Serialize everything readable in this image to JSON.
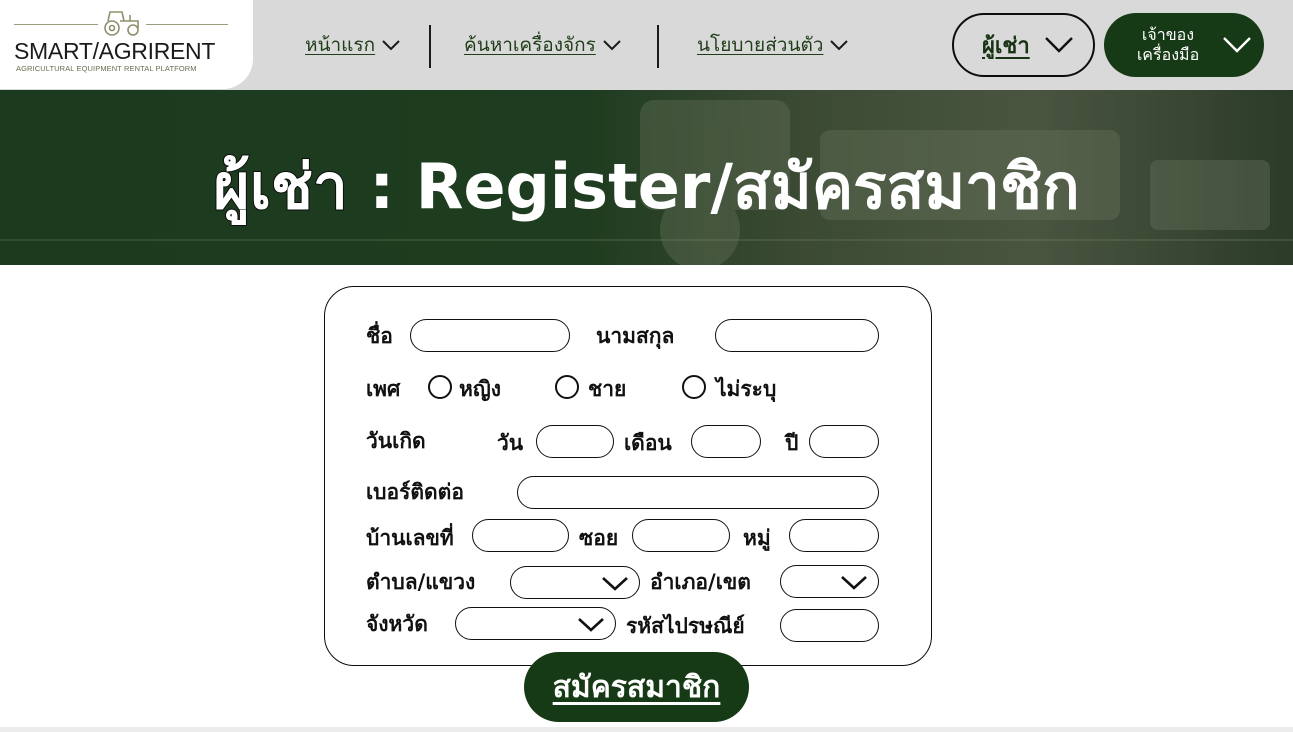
{
  "logo": {
    "title": "SMART/AGRIRENT",
    "subtitle": "AGRICULTURAL EQUIPMENT RENTAL PLATFORM"
  },
  "nav": {
    "home": "หน้าแรก",
    "search_machines": "ค้นหาเครื่องจักร",
    "privacy_policy": "นโยบายส่วนตัว"
  },
  "account_buttons": {
    "renter": "ผู้เช่า",
    "owner_line1": "เจ้าของ",
    "owner_line2": "เครื่องมือ"
  },
  "banner": {
    "role": "ผู้เช่า",
    "separator": " : ",
    "title": "Register/สมัครสมาชิก"
  },
  "form": {
    "first_name_label": "ชื่อ",
    "first_name_value": "",
    "last_name_label": "นามสกุล",
    "last_name_value": "",
    "gender_label": "เพศ",
    "gender_options": [
      "หญิง",
      "ชาย",
      "ไม่ระบุ"
    ],
    "birthdate_label": "วันเกิด",
    "day_label": "วัน",
    "month_label": "เดือน",
    "year_label": "ปี",
    "phone_label": "เบอร์ติดต่อ",
    "house_no_label": "บ้านเลขที่",
    "soi_label": "ซอย",
    "moo_label": "หมู่",
    "subdistrict_label": "ตำบล/แขวง",
    "district_label": "อำเภอ/เขต",
    "province_label": "จังหวัด",
    "postal_code_label": "รหัสไปรษณีย์",
    "submit_label": "สมัครสมาชิก"
  },
  "colors": {
    "header_bg": "#d9d9d9",
    "brand_green": "#173a16",
    "banner_green": "#1d3b1e",
    "text_green": "#1f3d17"
  }
}
